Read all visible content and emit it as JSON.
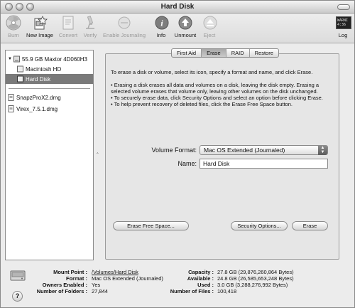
{
  "window": {
    "title": "Hard Disk"
  },
  "toolbar": {
    "items": [
      {
        "label": "Burn",
        "enabled": false
      },
      {
        "label": "New Image",
        "enabled": true
      },
      {
        "label": "Convert",
        "enabled": false
      },
      {
        "label": "Verify",
        "enabled": false
      },
      {
        "label": "Enable Journaling",
        "enabled": false
      },
      {
        "label": "Info",
        "enabled": true
      },
      {
        "label": "Unmount",
        "enabled": true
      },
      {
        "label": "Eject",
        "enabled": false
      },
      {
        "label": "Log",
        "enabled": true
      }
    ],
    "log_icon_text": "WARNI\n4:36"
  },
  "sidebar": {
    "disks": [
      {
        "label": "55.9 GB Maxtor 4D060H3",
        "level": 0,
        "selected": false
      },
      {
        "label": "Macintosh HD",
        "level": 1,
        "selected": false
      },
      {
        "label": "Hard Disk",
        "level": 1,
        "selected": true
      }
    ],
    "images": [
      {
        "label": "SnapzProX2.dmg"
      },
      {
        "label": "Virex_7.5.1.dmg"
      }
    ]
  },
  "tabs": [
    {
      "label": "First Aid",
      "active": false
    },
    {
      "label": "Erase",
      "active": true
    },
    {
      "label": "RAID",
      "active": false
    },
    {
      "label": "Restore",
      "active": false
    }
  ],
  "erase": {
    "intro": "To erase a disk or volume, select its icon, specify a format and name, and click Erase.",
    "bullets": [
      "• Erasing a disk erases all data and volumes on a disk, leaving the disk empty. Erasing a selected volume erases that volume only, leaving other volumes on the disk unchanged.",
      "• To securely erase data, click Security Options and select an option before clicking Erase.",
      "• To help prevent recovery of deleted files, click the Erase Free Space button."
    ],
    "format_label": "Volume Format:",
    "format_value": "Mac OS Extended (Journaled)",
    "name_label": "Name:",
    "name_value": "Hard Disk",
    "erase_free_space_button": "Erase Free Space...",
    "security_options_button": "Security Options...",
    "erase_button": "Erase"
  },
  "info": {
    "mount_point_label": "Mount Point :",
    "mount_point": "/Volumes/Hard Disk",
    "format_label": "Format :",
    "format": "Mac OS Extended (Journaled)",
    "owners_label": "Owners Enabled :",
    "owners": "Yes",
    "folders_label": "Number of Folders :",
    "folders": "27,844",
    "capacity_label": "Capacity :",
    "capacity": "27.8 GB (29,876,260,864 Bytes)",
    "available_label": "Available :",
    "available": "24.8 GB (26,585,653,248 Bytes)",
    "used_label": "Used :",
    "used": "3.0 GB (3,288,276,992 Bytes)",
    "files_label": "Number of Files :",
    "files": "100,418"
  },
  "icons": {
    "burn": "radiation-disc-icon",
    "new_image": "new-image-icon",
    "convert": "convert-document-icon",
    "verify": "microscope-icon",
    "enable_journaling": "journaling-icon",
    "info": "info-icon",
    "unmount": "unmount-icon",
    "eject": "eject-icon",
    "log": "console-log-icon",
    "help": "help-icon"
  },
  "colors": {
    "selection": "#7a7a7a",
    "disabled_text": "#9a9a9a"
  }
}
